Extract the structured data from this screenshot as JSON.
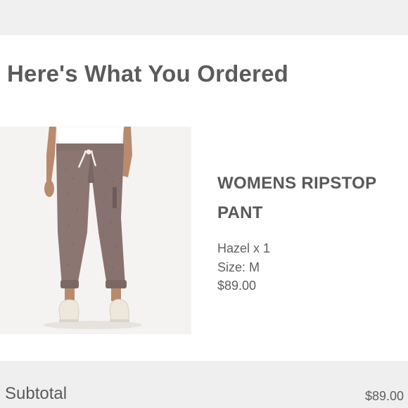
{
  "order": {
    "heading": "Here's What You Ordered"
  },
  "item": {
    "image_alt": "Womens Ripstop Pant product photo",
    "name": "WOMENS RIPSTOP PANT",
    "variant": "Hazel x 1",
    "size": "Size: M",
    "price": "$89.00"
  },
  "summary": {
    "subtotal_label": "Subtotal",
    "subtotal_value": "$89.00"
  },
  "colors": {
    "background": "#ffffff",
    "band": "#f0f0f0",
    "text": "#5a5a5a",
    "pant": "#8b7672"
  }
}
